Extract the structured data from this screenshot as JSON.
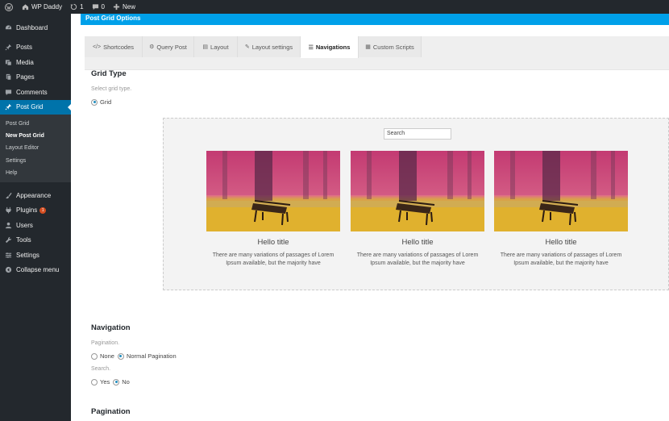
{
  "adminbar": {
    "site_name": "WP Daddy",
    "updates_count": "1",
    "comments_count": "0",
    "new_label": "New"
  },
  "sidebar": {
    "items": [
      {
        "label": "Dashboard",
        "icon": "dashboard-icon"
      },
      {
        "label": "Posts",
        "icon": "pin-icon"
      },
      {
        "label": "Media",
        "icon": "media-icon"
      },
      {
        "label": "Pages",
        "icon": "pages-icon"
      },
      {
        "label": "Comments",
        "icon": "comment-icon"
      },
      {
        "label": "Post Grid",
        "icon": "grid-icon"
      }
    ],
    "submenu": [
      "Post Grid",
      "New Post Grid",
      "Layout Editor",
      "Settings",
      "Help"
    ],
    "items2": [
      {
        "label": "Appearance",
        "icon": "brush-icon"
      },
      {
        "label": "Plugins",
        "icon": "plugin-icon",
        "badge": "1"
      },
      {
        "label": "Users",
        "icon": "users-icon"
      },
      {
        "label": "Tools",
        "icon": "wrench-icon"
      },
      {
        "label": "Settings",
        "icon": "settings-icon"
      },
      {
        "label": "Collapse menu",
        "icon": "collapse-icon"
      }
    ]
  },
  "header": {
    "title": "Post Grid Options"
  },
  "tabs": [
    {
      "label": "Shortcodes",
      "icon": "</>"
    },
    {
      "label": "Query Post",
      "icon": "⚙"
    },
    {
      "label": "Layout",
      "icon": "▤"
    },
    {
      "label": "Layout settings",
      "icon": "✎"
    },
    {
      "label": "Navigations",
      "icon": "☰"
    },
    {
      "label": "Custom Scripts",
      "icon": "▦"
    }
  ],
  "grid_type": {
    "title": "Grid Type",
    "hint": "Select grid type.",
    "option": "Grid"
  },
  "preview": {
    "search_value": "Search",
    "cards": [
      {
        "title": "Hello title",
        "excerpt": "There are many variations of passages of Lorem Ipsum available, but the majority have"
      },
      {
        "title": "Hello title",
        "excerpt": "There are many variations of passages of Lorem Ipsum available, but the majority have"
      },
      {
        "title": "Hello title",
        "excerpt": "There are many variations of passages of Lorem Ipsum available, but the majority have"
      }
    ]
  },
  "navigation": {
    "title": "Navigation",
    "pagination_label": "Pagination.",
    "pagination_options": [
      "None",
      "Normal Pagination"
    ],
    "search_label": "Search.",
    "search_options": [
      "Yes",
      "No"
    ]
  },
  "pagination": {
    "title": "Pagination"
  },
  "colors": {
    "adminbar": "#23282d",
    "sidebar": "#23282d",
    "active_menu": "#0073aa",
    "header_bar": "#00a0e9",
    "badge": "#d54e21"
  }
}
